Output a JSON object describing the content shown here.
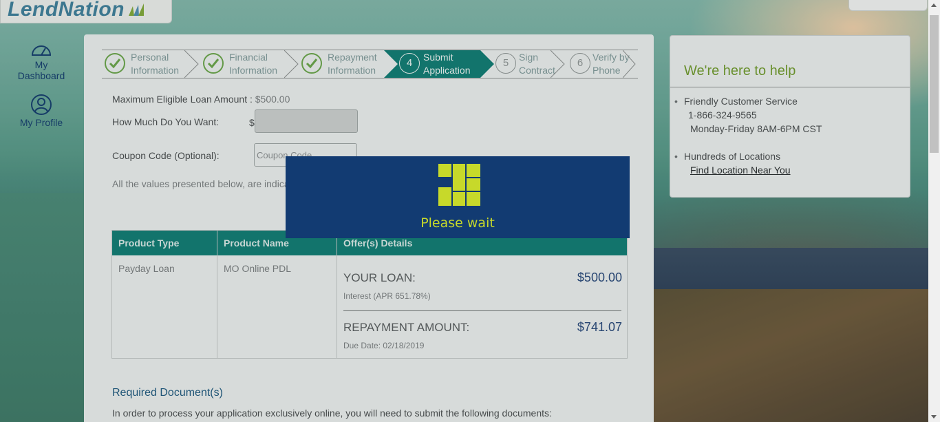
{
  "brand": {
    "logo_text": "LendNation"
  },
  "sidebar": {
    "items": [
      {
        "label_line1": "My",
        "label_line2": "Dashboard",
        "icon": "dashboard-gauge-icon"
      },
      {
        "label": "My Profile",
        "icon": "profile-person-icon"
      }
    ]
  },
  "stepper": {
    "steps": [
      {
        "line1": "Personal",
        "line2": "Information",
        "state": "done"
      },
      {
        "line1": "Financial",
        "line2": "Information",
        "state": "done"
      },
      {
        "line1": "Repayment",
        "line2": "Information",
        "state": "done"
      },
      {
        "number": "4",
        "line1": "Submit",
        "line2": "Application",
        "state": "active"
      },
      {
        "number": "5",
        "line1": "Sign",
        "line2": "Contract",
        "state": "pending"
      },
      {
        "number": "6",
        "line1": "Verify by",
        "line2": "Phone",
        "state": "pending"
      }
    ]
  },
  "form": {
    "max_label": "Maximum Eligible Loan Amount : ",
    "max_value": "$500.00",
    "want_label": "How Much Do You Want:",
    "currency_symbol": "$",
    "want_value": "",
    "coupon_label": "Coupon Code (Optional):",
    "coupon_placeholder": "Coupon Code",
    "disclaimer": "All the values presented below, are indicati"
  },
  "offer_table": {
    "headers": [
      "Product Type",
      "Product Name",
      "Offer(s) Details"
    ],
    "row": {
      "product_type": "Payday Loan",
      "product_name": "MO Online PDL",
      "your_loan_label": "YOUR LOAN:",
      "your_loan_amount": "$500.00",
      "interest": "Interest (APR 651.78%)",
      "repayment_label": "REPAYMENT AMOUNT:",
      "repayment_amount": "$741.07",
      "due_date": "Due Date: 02/18/2019"
    }
  },
  "documents": {
    "title": "Required Document(s)",
    "text": "In order to process your application exclusively online, you will need to submit the following documents:"
  },
  "help": {
    "title": "We're here to help",
    "service_label": "Friendly Customer Service",
    "phone": "1-866-324-9565",
    "hours": "Monday-Friday 8AM-6PM CST",
    "locations_label": "Hundreds of Locations",
    "locations_link": "Find Location Near You"
  },
  "modal": {
    "text": "Please wait",
    "icon": "loading-grid-icon"
  },
  "colors": {
    "teal": "#127c74",
    "navy_modal": "#123b72",
    "accent_yellow": "#c7d92a",
    "help_green": "#6f9a2e"
  }
}
